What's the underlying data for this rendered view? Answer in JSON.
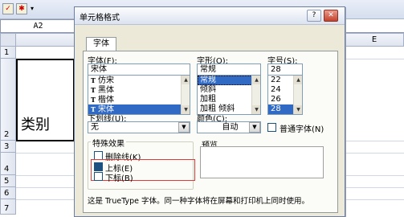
{
  "sheet": {
    "name_box": "A2",
    "column_e": "E",
    "rows": [
      "1",
      "2",
      "3",
      "4",
      "5",
      "6",
      "7"
    ],
    "cell_a2": "类别"
  },
  "dialog": {
    "title": "单元格格式",
    "help_btn": "?",
    "close_btn": "✕",
    "tab": "字体",
    "font_label": "字体(F):",
    "font_value": "宋体",
    "font_items": [
      "仿宋",
      "黑体",
      "楷体",
      "宋体"
    ],
    "style_label": "字形(O):",
    "style_value": "常规",
    "style_items": [
      "常规",
      "倾斜",
      "加粗",
      "加粗 倾斜"
    ],
    "size_label": "字号(S):",
    "size_value": "28",
    "size_items": [
      "22",
      "24",
      "26",
      "28"
    ],
    "underline_label": "下划线(U):",
    "underline_value": "无",
    "color_label": "颜色(C):",
    "color_value": "自动",
    "normal_font_label": "普通字体(N)",
    "effects_label": "特殊效果",
    "strike_label": "删除线(K)",
    "super_label": "上标(E)",
    "sub_label": "下标(B)",
    "preview_label": "预览",
    "info": "这是 TrueType 字体。同一种字体将在屏幕和打印机上同时使用。"
  }
}
